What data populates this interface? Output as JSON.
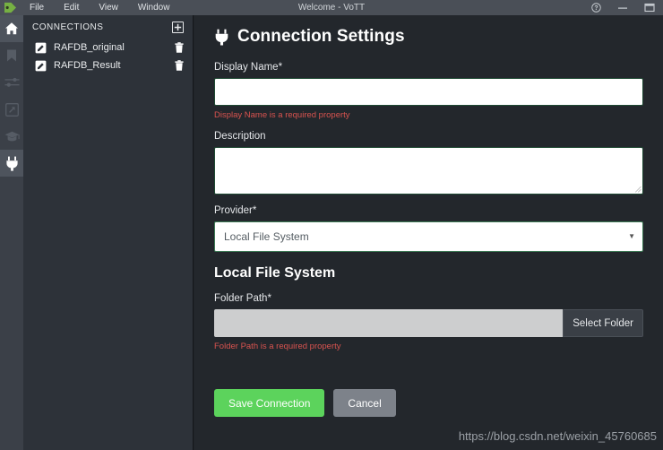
{
  "window": {
    "title": "Welcome - VoTT",
    "logo_icon": "green-tag-logo",
    "menu": [
      {
        "label": "File"
      },
      {
        "label": "Edit"
      },
      {
        "label": "View"
      },
      {
        "label": "Window"
      }
    ],
    "controls": [
      {
        "name": "help-button",
        "icon": "question-circle-icon",
        "glyph": "?"
      },
      {
        "name": "minimize-button",
        "icon": "minimize-icon",
        "glyph": "—"
      },
      {
        "name": "maximize-button",
        "icon": "maximize-icon",
        "glyph": "□"
      }
    ]
  },
  "iconbar": {
    "items": [
      {
        "name": "sidebar-item-home",
        "icon": "home-icon",
        "active": true,
        "dim": false
      },
      {
        "name": "sidebar-item-tags",
        "icon": "bookmark-icon",
        "active": false,
        "dim": true
      },
      {
        "name": "sidebar-item-settings",
        "icon": "sliders-icon",
        "active": false,
        "dim": true
      },
      {
        "name": "sidebar-item-export",
        "icon": "export-arrow-icon",
        "active": false,
        "dim": true
      },
      {
        "name": "sidebar-item-active-learning",
        "icon": "graduation-cap-icon",
        "active": false,
        "dim": true
      },
      {
        "name": "sidebar-item-connections",
        "icon": "plug-icon",
        "active": true,
        "dim": false
      }
    ]
  },
  "connections": {
    "header": "CONNECTIONS",
    "add_icon": "plus-icon",
    "add_label": "+",
    "items": [
      {
        "label": "RAFDB_original",
        "edit_icon": "edit-square-icon",
        "delete_icon": "trash-icon"
      },
      {
        "label": "RAFDB_Result",
        "edit_icon": "edit-square-icon",
        "delete_icon": "trash-icon"
      }
    ]
  },
  "form": {
    "title": "Connection Settings",
    "title_icon": "plug-icon",
    "display_name": {
      "label": "Display Name*",
      "value": "",
      "placeholder": "",
      "error": "Display Name is a required property"
    },
    "description": {
      "label": "Description",
      "value": "",
      "placeholder": ""
    },
    "provider": {
      "label": "Provider*",
      "selected": "Local File System",
      "caret_icon": "chevron-down-icon",
      "options": [
        "Local File System"
      ]
    },
    "section": {
      "title": "Local File System",
      "folder_path": {
        "label": "Folder Path*",
        "value": "",
        "placeholder": "",
        "error": "Folder Path is a required property",
        "button_label": "Select Folder"
      }
    },
    "actions": {
      "save_label": "Save Connection",
      "cancel_label": "Cancel"
    }
  },
  "watermark": "https://blog.csdn.net/weixin_45760685",
  "colors": {
    "accent_green": "#5cd35c",
    "logo_green": "#6aa84f",
    "error_red": "#d9534f",
    "titlebar": "#4a4f57",
    "iconbar": "#3b4048",
    "panel": "#2d3239",
    "main_bg": "#23272c"
  }
}
